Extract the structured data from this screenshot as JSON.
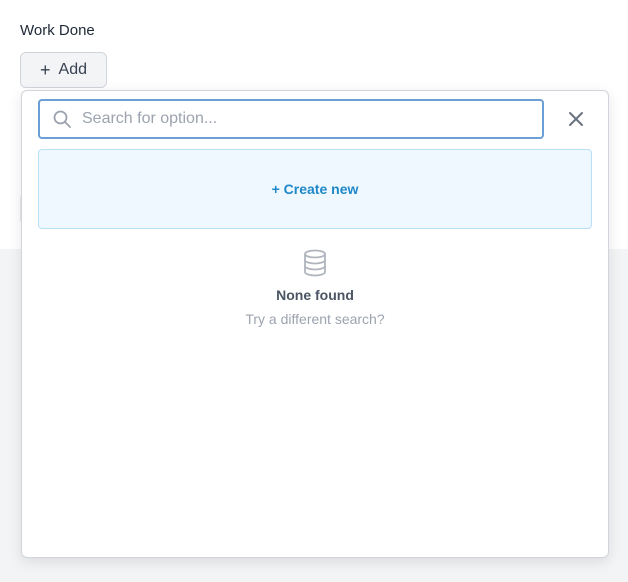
{
  "field": {
    "label": "Work Done"
  },
  "add_button": {
    "icon": "plus-icon",
    "label": "Add"
  },
  "search": {
    "placeholder": "Search for option...",
    "value": "",
    "icon": "search-icon"
  },
  "close": {
    "icon": "close-icon"
  },
  "create_new": {
    "label": "+ Create new"
  },
  "empty_state": {
    "icon": "database-icon",
    "title": "None found",
    "subtitle": "Try a different search?"
  },
  "colors": {
    "accent": "#1e88c8",
    "focus_border": "#6b9fd6",
    "create_bg": "#eff8fe"
  }
}
